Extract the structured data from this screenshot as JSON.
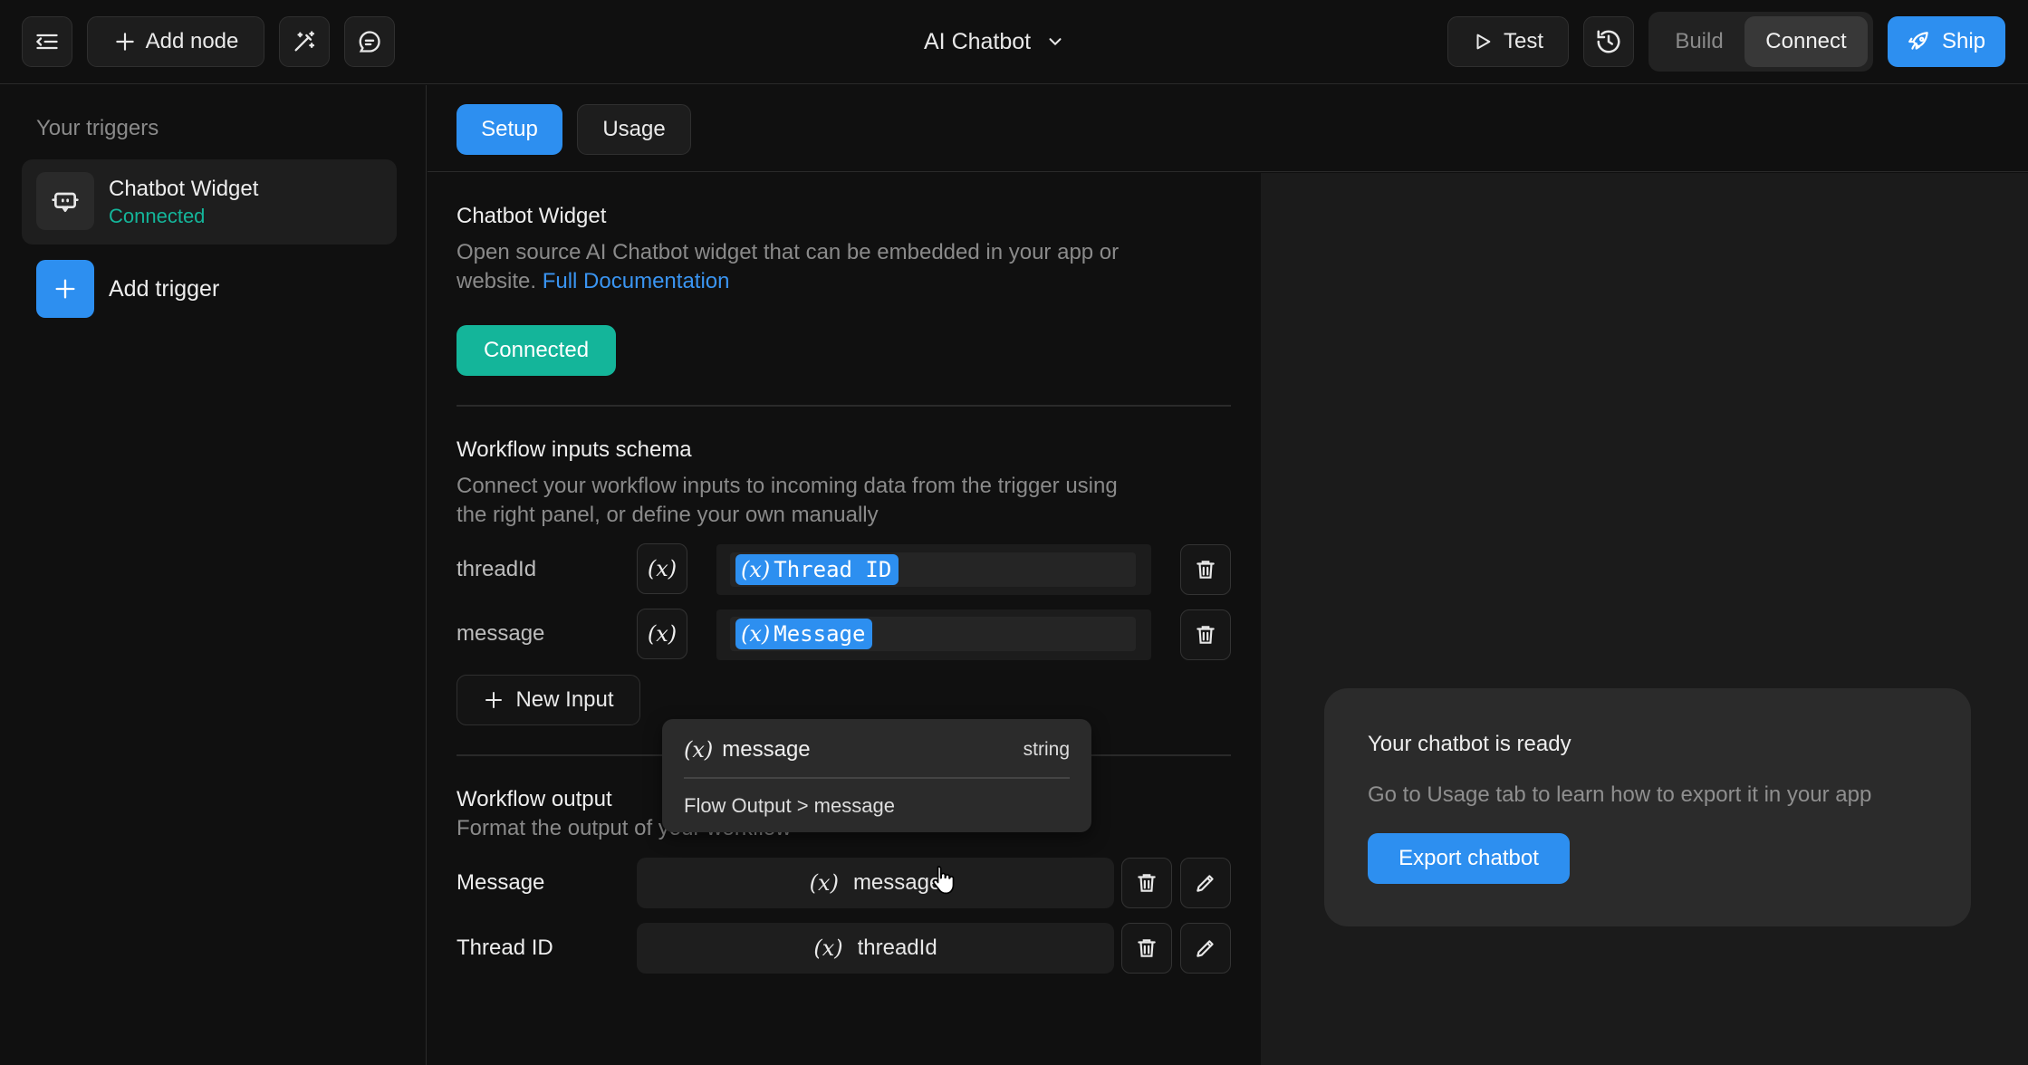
{
  "toolbar": {
    "add_node_label": "Add node",
    "title": "AI Chatbot",
    "test_label": "Test",
    "build_label": "Build",
    "connect_label": "Connect",
    "ship_label": "Ship"
  },
  "sidebar": {
    "heading": "Your triggers",
    "trigger": {
      "name": "Chatbot Widget",
      "status": "Connected"
    },
    "add_trigger_label": "Add trigger"
  },
  "tabs": [
    {
      "label": "Setup",
      "active": true
    },
    {
      "label": "Usage",
      "active": false
    }
  ],
  "widget": {
    "title": "Chatbot Widget",
    "desc_line1": "Open source AI Chatbot widget that can be embedded in your app or",
    "desc_line2": "website.",
    "doc_link": "Full Documentation",
    "status_button": "Connected"
  },
  "inputs_schema": {
    "title": "Workflow inputs schema",
    "desc_line1": "Connect your workflow inputs to incoming data from the trigger using",
    "desc_line2": "the right panel, or define your own manually",
    "rows": [
      {
        "name": "threadId",
        "chip": "Thread ID"
      },
      {
        "name": "message",
        "chip": "Message"
      }
    ],
    "new_input_label": "New Input"
  },
  "dropdown": {
    "item_name": "message",
    "item_type": "string",
    "path": "Flow Output > message"
  },
  "output": {
    "title": "Workflow output",
    "desc": "Format the output of your workflow",
    "rows": [
      {
        "label": "Message",
        "value": "message"
      },
      {
        "label": "Thread ID",
        "value": "threadId"
      }
    ]
  },
  "ready_card": {
    "title": "Your chatbot is ready",
    "desc": "Go to Usage tab to learn how to export it in your app",
    "button": "Export chatbot"
  },
  "variable_glyph": "(x)",
  "colors": {
    "accent": "#2d8ff0",
    "success": "#14b59a",
    "background": "#101010"
  }
}
